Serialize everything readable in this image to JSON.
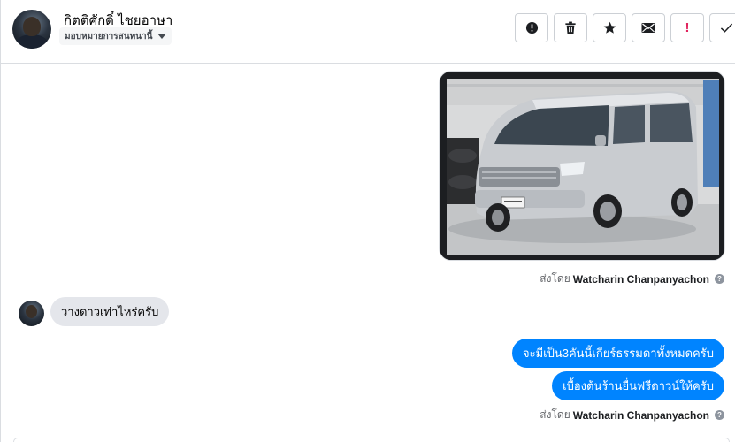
{
  "header": {
    "contact_name": "กิตติศักดิ์ ไชยอาษา",
    "assign_label": "มอบหมายการสนทนานี้",
    "actions": [
      {
        "name": "spam-button",
        "icon": "alert-circle-icon"
      },
      {
        "name": "delete-button",
        "icon": "trash-icon"
      },
      {
        "name": "star-button",
        "icon": "star-icon"
      },
      {
        "name": "mark-unread-button",
        "icon": "envelope-icon"
      },
      {
        "name": "follow-up-button",
        "icon": "exclamation-icon",
        "label": "!"
      },
      {
        "name": "mark-done-button",
        "icon": "checkmark-icon"
      }
    ]
  },
  "messages": {
    "image_sent_by_prefix": "ส่งโดย",
    "image_sent_by_name": "Watcharin Chanpanyachon",
    "incoming_text": "วางดาวเท่าไหร่ครับ",
    "outgoing_1": "จะมีเป็น3คันนี้เกียร์ธรรมดาทั้งหมดครับ",
    "outgoing_2": "เบื้องต้นร้านยื่นฟรีดาวน์ให้ครับ",
    "text_sent_by_prefix": "ส่งโดย",
    "text_sent_by_name": "Watcharin Chanpanyachon",
    "help_glyph": "?"
  },
  "colors": {
    "outgoing_bubble": "#0084ff",
    "incoming_bubble": "#e4e6eb",
    "follow_up_red": "#e0245e"
  }
}
